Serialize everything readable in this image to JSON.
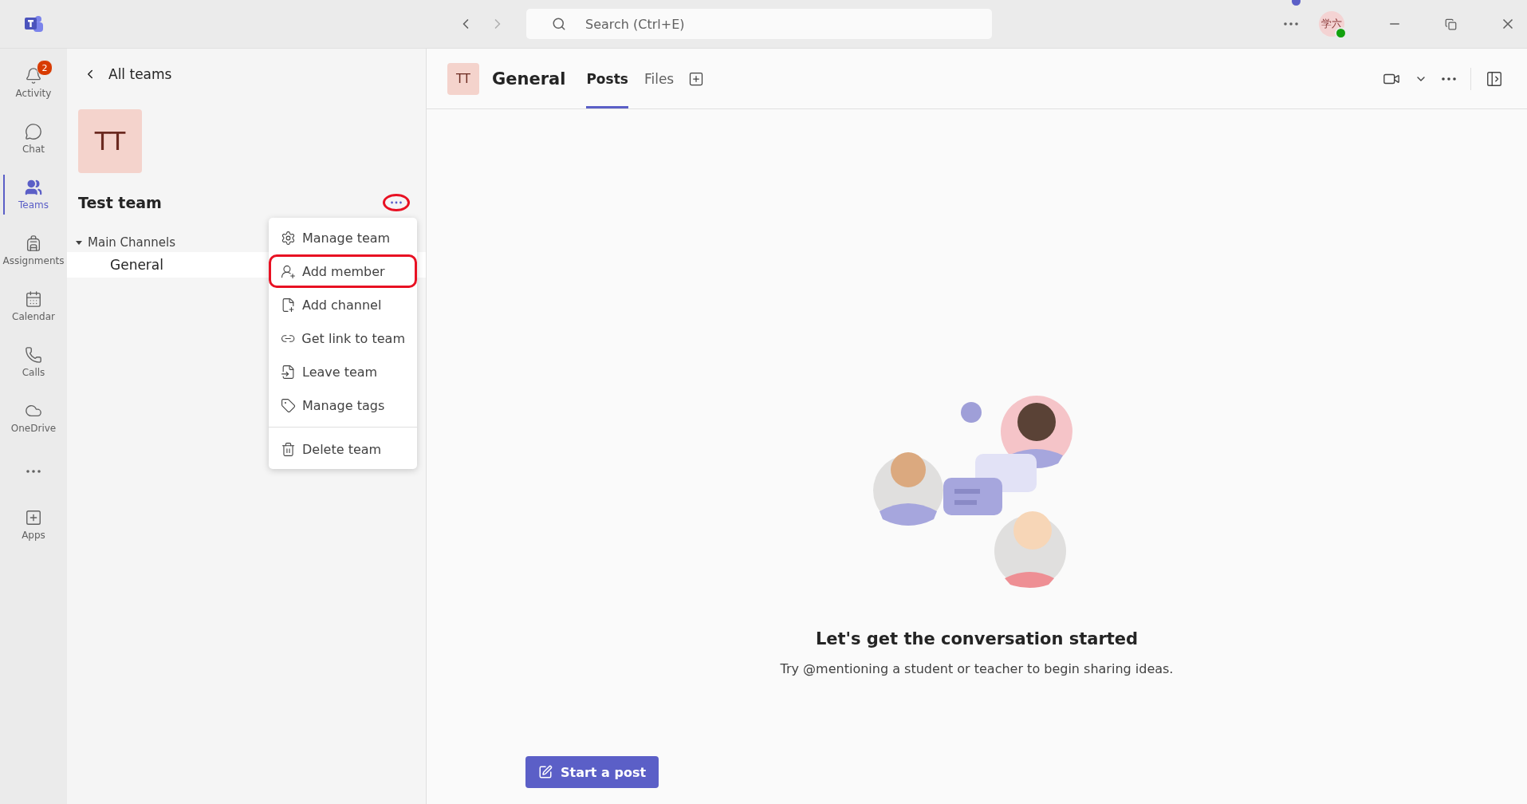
{
  "title_bar": {
    "search": {
      "placeholder": "Search (Ctrl+E)"
    },
    "account": {
      "initials": "学六"
    }
  },
  "rail": {
    "items": [
      {
        "label": "Activity",
        "selected": false,
        "badge": "2"
      },
      {
        "label": "Chat",
        "selected": false
      },
      {
        "label": "Teams",
        "selected": true
      },
      {
        "label": "Assignments",
        "selected": false
      },
      {
        "label": "Calendar",
        "selected": false
      },
      {
        "label": "Calls",
        "selected": false
      },
      {
        "label": "OneDrive",
        "selected": false
      }
    ],
    "apps": {
      "label": "Apps"
    }
  },
  "team_panel": {
    "back_label": "All teams",
    "team_initials": "TT",
    "team_name": "Test team",
    "more_highlighted": true,
    "channel_group": {
      "label": "Main Channels",
      "expanded": true,
      "channels": [
        {
          "name": "General",
          "selected": true
        }
      ]
    }
  },
  "menu": {
    "items": [
      {
        "label": "Manage team",
        "highlighted": false,
        "separator_before": false
      },
      {
        "label": "Add member",
        "highlighted": true,
        "separator_before": false
      },
      {
        "label": "Add channel",
        "highlighted": false,
        "separator_before": false
      },
      {
        "label": "Get link to team",
        "highlighted": false,
        "separator_before": false
      },
      {
        "label": "Leave team",
        "highlighted": false,
        "separator_before": false
      },
      {
        "label": "Manage tags",
        "highlighted": false,
        "separator_before": false
      },
      {
        "label": "Delete team",
        "highlighted": false,
        "separator_before": true
      }
    ]
  },
  "channel_header": {
    "initials": "TT",
    "name": "General",
    "tabs": [
      {
        "label": "Posts",
        "selected": true
      },
      {
        "label": "Files",
        "selected": false
      }
    ]
  },
  "empty_state": {
    "title": "Let's get the conversation started",
    "text": "Try @mentioning a student or teacher to begin sharing ideas."
  },
  "compose": {
    "button": "Start a post"
  }
}
